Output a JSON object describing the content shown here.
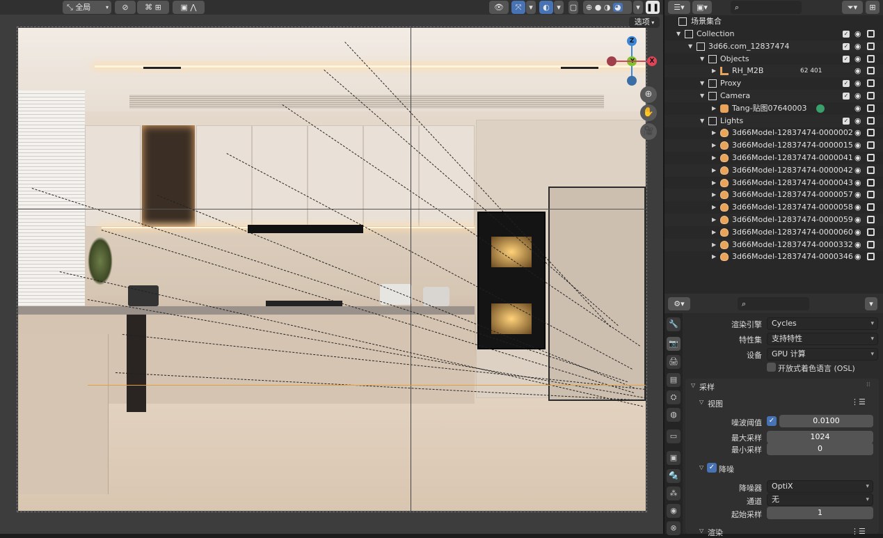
{
  "viewport": {
    "header": {
      "transform_orientation": "全局",
      "options_label": "选项"
    },
    "gizmo": {
      "z": "Z",
      "y": "-Y",
      "x": "X"
    },
    "colors": {
      "accent": "#4772b3",
      "axis_x": "#e04457",
      "axis_y": "#7ec22d",
      "axis_z": "#3b86d6"
    }
  },
  "outliner": {
    "root": "场景集合",
    "rows": [
      {
        "label": "Collection",
        "type": "collection",
        "level": 1
      },
      {
        "label": "3d66.com_12837474",
        "type": "collection",
        "level": 2
      },
      {
        "label": "Objects",
        "type": "collection",
        "level": 3
      },
      {
        "label": "RH_M2B",
        "type": "armature",
        "level": 4,
        "extra": "62 401"
      },
      {
        "label": "Proxy",
        "type": "collection",
        "level": 3
      },
      {
        "label": "Camera",
        "type": "collection",
        "level": 3
      },
      {
        "label": "Tang-贴图07640003",
        "type": "camera",
        "level": 4
      },
      {
        "label": "Lights",
        "type": "collection",
        "level": 3
      },
      {
        "label": "3d66Model-12837474-0000002",
        "type": "light",
        "level": 4
      },
      {
        "label": "3d66Model-12837474-0000015",
        "type": "light",
        "level": 4
      },
      {
        "label": "3d66Model-12837474-0000041",
        "type": "light",
        "level": 4
      },
      {
        "label": "3d66Model-12837474-0000042",
        "type": "light",
        "level": 4
      },
      {
        "label": "3d66Model-12837474-0000043",
        "type": "light",
        "level": 4
      },
      {
        "label": "3d66Model-12837474-0000057",
        "type": "light",
        "level": 4
      },
      {
        "label": "3d66Model-12837474-0000058",
        "type": "light",
        "level": 4
      },
      {
        "label": "3d66Model-12837474-0000059",
        "type": "light",
        "level": 4
      },
      {
        "label": "3d66Model-12837474-0000060",
        "type": "light",
        "level": 4
      },
      {
        "label": "3d66Model-12837474-0000332",
        "type": "light",
        "level": 4
      },
      {
        "label": "3d66Model-12837474-0000346",
        "type": "light",
        "level": 4
      }
    ]
  },
  "properties": {
    "render_engine_label": "渲染引擎",
    "render_engine": "Cycles",
    "feature_set_label": "特性集",
    "feature_set": "支持特性",
    "device_label": "设备",
    "device": "GPU 计算",
    "osl_label": "开放式着色语言 (OSL)",
    "sampling_title": "采样",
    "viewport_title": "视图",
    "noise_threshold_label": "噪波阈值",
    "noise_threshold": "0.0100",
    "max_samples_label": "最大采样",
    "max_samples": "1024",
    "min_samples_label": "最小采样",
    "min_samples": "0",
    "denoise_title": "降噪",
    "denoiser_label": "降噪器",
    "denoiser": "OptiX",
    "passes_label": "通道",
    "passes": "无",
    "start_sample_label": "起始采样",
    "start_sample": "1",
    "render_title": "渲染"
  }
}
